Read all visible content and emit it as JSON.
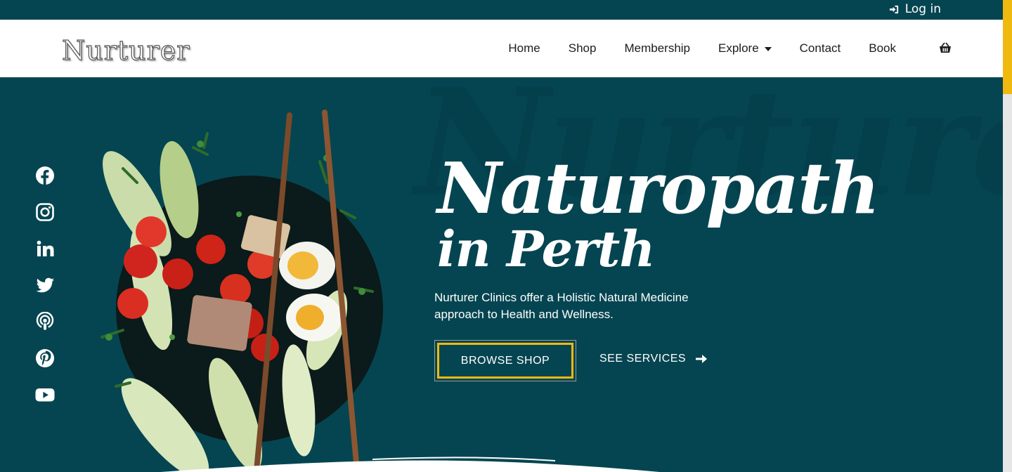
{
  "topbar": {
    "login_label": "Log in"
  },
  "header": {
    "logo_text": "Nurturer",
    "nav": [
      {
        "label": "Home"
      },
      {
        "label": "Shop"
      },
      {
        "label": "Membership"
      },
      {
        "label": "Explore"
      },
      {
        "label": "Contact"
      },
      {
        "label": "Book"
      }
    ]
  },
  "hero": {
    "watermark": "Nurturer",
    "title_line1": "Naturopath",
    "title_line2": "in Perth",
    "description": "Nurturer Clinics offer a Holistic Natural Medicine approach to Health and Wellness.",
    "primary_button": "BROWSE SHOP",
    "secondary_button": "SEE SERVICES",
    "socials": [
      "facebook-icon",
      "instagram-icon",
      "linkedin-icon",
      "twitter-icon",
      "podcast-icon",
      "pinterest-icon",
      "youtube-icon"
    ]
  },
  "colors": {
    "primary": "#054551",
    "accent": "#f0b90f",
    "header_bg": "#ffffff",
    "text_light": "#ffffff",
    "text_dark": "#1c1c1c"
  }
}
